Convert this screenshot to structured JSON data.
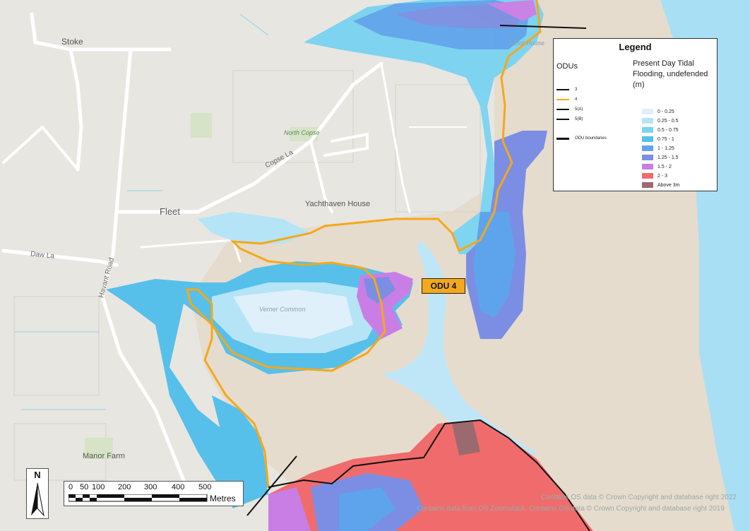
{
  "map": {
    "places": {
      "stoke": "Stoke",
      "fleet": "Fleet",
      "manor_farm": "Manor Farm",
      "yachthaven_house": "Yachthaven House",
      "point_house": "Point House",
      "north_copse": "North Copse",
      "verner_common": "Verner Common"
    },
    "roads": {
      "copse_la": "Copse La",
      "daw_la": "Daw La",
      "havant_road": "Havant Road"
    },
    "unit_tag": "ODU 4"
  },
  "legend": {
    "title": "Legend",
    "odu_heading": "ODUs",
    "flood_heading": "Present Day Tidal Flooding, undefended (m)",
    "odu_items": [
      {
        "label": "3",
        "color": "#111111"
      },
      {
        "label": "4",
        "color": "#f4a81b"
      },
      {
        "label": "5(A)",
        "color": "#111111"
      },
      {
        "label": "5(B)",
        "color": "#111111"
      },
      {
        "label": "ODU boundaries",
        "color": "#111111"
      }
    ],
    "flood_items": [
      {
        "label": "0 - 0.25",
        "color": "#dff0fb"
      },
      {
        "label": "0.25 - 0.5",
        "color": "#b5e4f7"
      },
      {
        "label": "0.5 - 0.75",
        "color": "#79d3f1"
      },
      {
        "label": "0.75 - 1",
        "color": "#56c0ea"
      },
      {
        "label": "1 - 1.25",
        "color": "#5ea4ec"
      },
      {
        "label": "1.25 - 1.5",
        "color": "#7b8ee3"
      },
      {
        "label": "1.5 - 2",
        "color": "#c97ee6"
      },
      {
        "label": "2 - 3",
        "color": "#f06c6c"
      },
      {
        "label": "Above 3m",
        "color": "#9a6a6e"
      }
    ]
  },
  "scale": {
    "ticks": [
      "0",
      "50",
      "100",
      "200",
      "300",
      "400",
      "500"
    ],
    "unit": "Metres"
  },
  "north_arrow": "N",
  "attribution": {
    "line1": "Contains OS data © Crown Copyright and database right 2022",
    "line2": "Contains data from OS Zoomstack. Contains OS data © Crown Copyright and database right 2019"
  },
  "colors": {
    "land": "#e8e6e1",
    "mudflat": "#e6dccd",
    "water": "#a9dff4",
    "odu4_line": "#f4a81b"
  }
}
